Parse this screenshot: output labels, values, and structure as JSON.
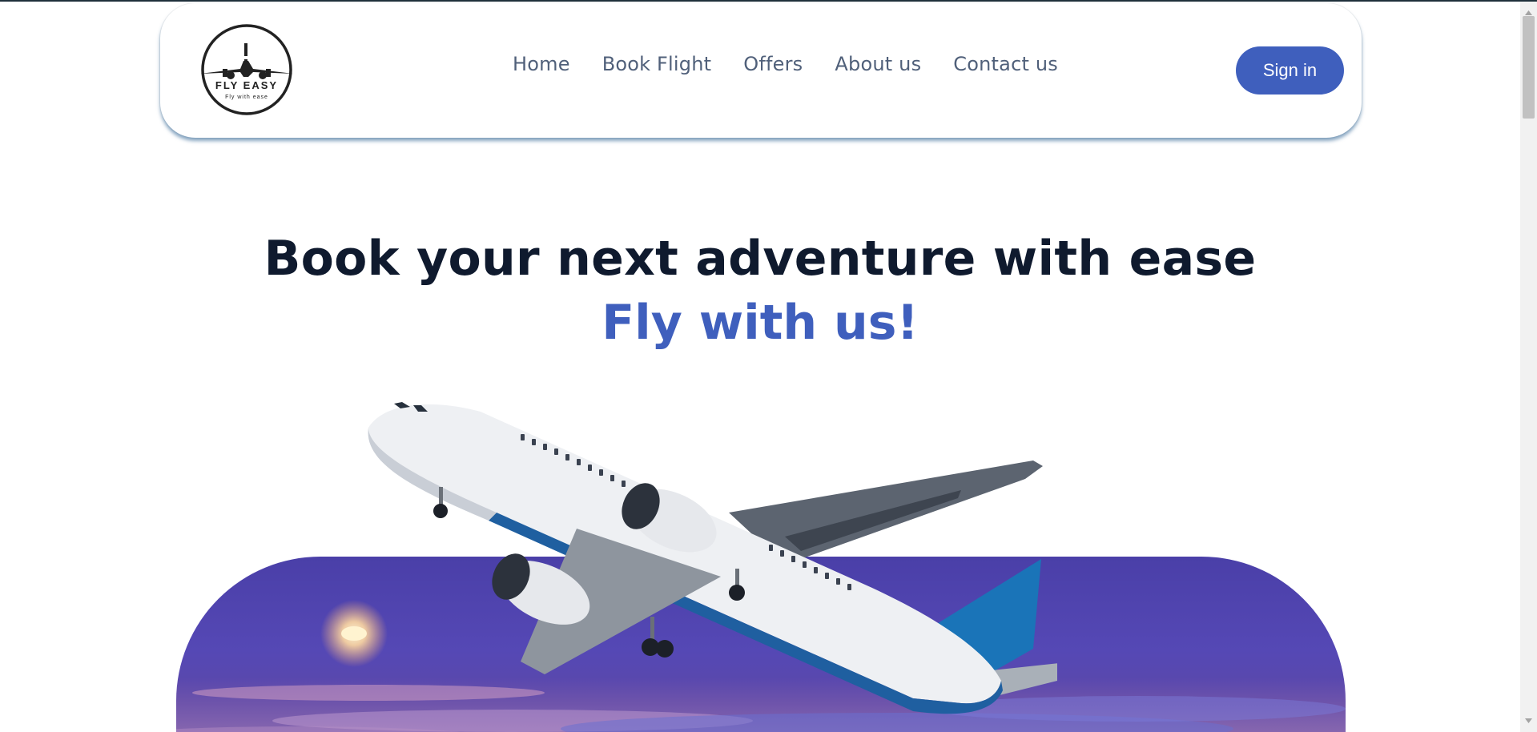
{
  "brand": {
    "name": "FLY EASY",
    "tagline": "Fly with ease",
    "logo_icon": "airplane-logo-icon"
  },
  "nav": {
    "items": [
      {
        "label": "Home"
      },
      {
        "label": "Book Flight"
      },
      {
        "label": "Offers"
      },
      {
        "label": "About us"
      },
      {
        "label": "Contact us"
      }
    ],
    "signin_label": "Sign in"
  },
  "hero": {
    "title": "Book your next adventure with ease",
    "subtitle": "Fly with us!"
  },
  "colors": {
    "accent": "#3f5fbd",
    "title": "#0f1a2e",
    "nav_text": "#50607a",
    "sky": "#5548b5"
  }
}
